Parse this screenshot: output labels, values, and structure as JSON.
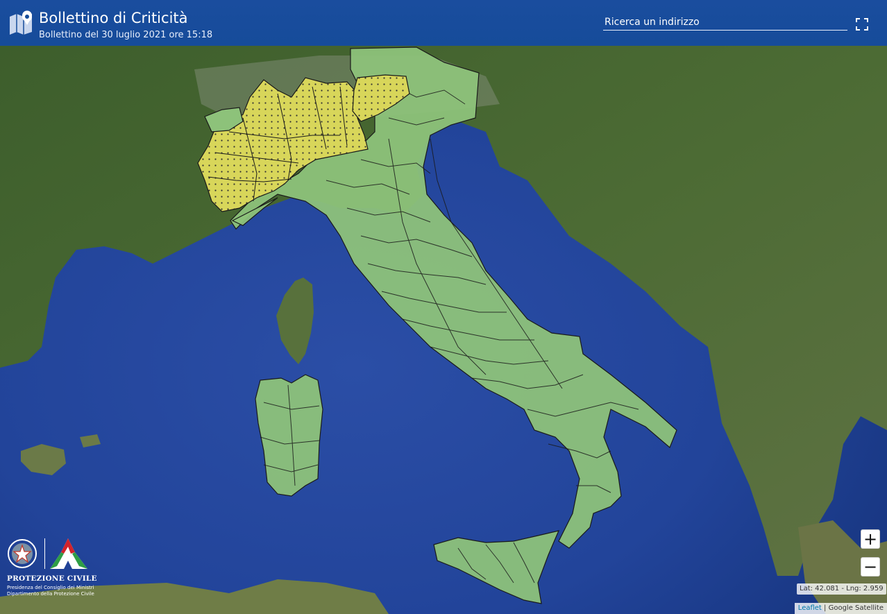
{
  "header": {
    "title": "Bollettino di Criticità",
    "subtitle": "Bollettino del 30 luglio 2021 ore 15:18",
    "search_placeholder": "Ricerca un indirizzo"
  },
  "map": {
    "basemap": "satellite",
    "region": "Italy",
    "alert_levels": [
      {
        "level": "green",
        "color": "#8dc27a",
        "areas": "most of Italy incl. Sardinia and Sicily"
      },
      {
        "level": "yellow",
        "color": "#d8d65a",
        "areas": "Piemonte, Valle d'Aosta, Lombardia, Trentino (north-west Alps)"
      }
    ]
  },
  "controls": {
    "zoom_in": "+",
    "zoom_out": "−",
    "fullscreen_icon": "fullscreen-icon"
  },
  "coordinates": "Lat: 42.081 - Lng: 2.959",
  "attribution": {
    "leaflet": "Leaflet",
    "separator": " | ",
    "provider": "Google Satellite"
  },
  "logo": {
    "org": "PROTEZIONE CIVILE",
    "line1": "Presidenza del Consiglio dei Ministri",
    "line2": "Dipartimento della Protezione Civile"
  },
  "colors": {
    "header": "#164c9a",
    "sea": "#1e3f8f",
    "land": "#3a5a2a",
    "alert_green": "#8dc27a",
    "alert_yellow": "#d8d65a"
  }
}
